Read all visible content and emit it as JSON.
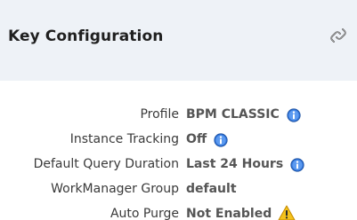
{
  "panel": {
    "title": "Key Configuration",
    "link_icon": "chain-link-icon"
  },
  "rows": [
    {
      "label": "Profile",
      "value": "BPM CLASSIC",
      "icon": "info-icon"
    },
    {
      "label": "Instance Tracking",
      "value": "Off",
      "icon": "info-icon"
    },
    {
      "label": "Default Query Duration",
      "value": "Last 24 Hours",
      "icon": "info-icon"
    },
    {
      "label": "WorkManager Group",
      "value": "default",
      "icon": ""
    },
    {
      "label": "Auto Purge",
      "value": "Not Enabled",
      "icon": "warning-icon"
    }
  ],
  "colors": {
    "header_bg": "#eef2f7",
    "info_blue": "#2f73d8",
    "warning_yellow": "#f4c21b"
  }
}
